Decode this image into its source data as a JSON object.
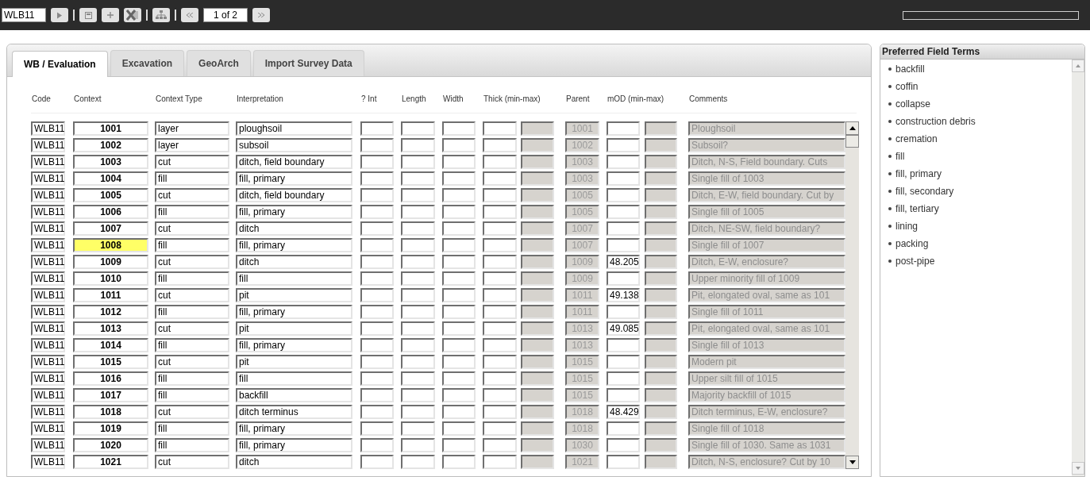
{
  "toolbar": {
    "record_code": "WLB11",
    "page": "1 of 2"
  },
  "tabs": [
    {
      "label": "WB / Evaluation",
      "selected": true
    },
    {
      "label": "Excavation",
      "selected": false
    },
    {
      "label": "GeoArch",
      "selected": false
    },
    {
      "label": "Import Survey Data",
      "selected": false
    }
  ],
  "columns": [
    "Code",
    "Context",
    "Context Type",
    "Interpretation",
    "? Int",
    "Length",
    "Width",
    "Thick (min-max)",
    "Parent",
    "mOD (min-max)",
    "Comments"
  ],
  "rows": [
    {
      "code": "WLB11",
      "context": "1001",
      "selected": false,
      "context_type": "layer",
      "interpretation": "ploughsoil",
      "parent": "1001",
      "comment": "Ploughsoil"
    },
    {
      "code": "WLB11",
      "context": "1002",
      "selected": false,
      "context_type": "layer",
      "interpretation": "subsoil",
      "parent": "1002",
      "comment": "Subsoil?"
    },
    {
      "code": "WLB11",
      "context": "1003",
      "selected": false,
      "context_type": "cut",
      "interpretation": "ditch, field boundary",
      "parent": "1003",
      "comment": "Ditch, N-S, Field boundary. Cuts"
    },
    {
      "code": "WLB11",
      "context": "1004",
      "selected": false,
      "context_type": "fill",
      "interpretation": "fill, primary",
      "parent": "1003",
      "comment": "Single fill of 1003"
    },
    {
      "code": "WLB11",
      "context": "1005",
      "selected": false,
      "context_type": "cut",
      "interpretation": "ditch, field boundary",
      "parent": "1005",
      "comment": "Ditch, E-W, field boundary. Cut by"
    },
    {
      "code": "WLB11",
      "context": "1006",
      "selected": false,
      "context_type": "fill",
      "interpretation": "fill, primary",
      "parent": "1005",
      "comment": "Single fill of 1005"
    },
    {
      "code": "WLB11",
      "context": "1007",
      "selected": false,
      "context_type": "cut",
      "interpretation": "ditch",
      "parent": "1007",
      "comment": "Ditch, NE-SW, field boundary?"
    },
    {
      "code": "WLB11",
      "context": "1008",
      "selected": true,
      "context_type": "fill",
      "interpretation": "fill, primary",
      "parent": "1007",
      "comment": "Single fill of 1007"
    },
    {
      "code": "WLB11",
      "context": "1009",
      "selected": false,
      "context_type": "cut",
      "interpretation": "ditch",
      "parent": "1009",
      "mod_min": "48.205",
      "comment": "Ditch, E-W, enclosure?"
    },
    {
      "code": "WLB11",
      "context": "1010",
      "selected": false,
      "context_type": "fill",
      "interpretation": "fill",
      "parent": "1009",
      "comment": "Upper minority fill of 1009"
    },
    {
      "code": "WLB11",
      "context": "1011",
      "selected": false,
      "context_type": "cut",
      "interpretation": "pit",
      "parent": "1011",
      "mod_min": "49.138",
      "comment": "Pit, elongated oval, same as 101"
    },
    {
      "code": "WLB11",
      "context": "1012",
      "selected": false,
      "context_type": "fill",
      "interpretation": "fill, primary",
      "parent": "1011",
      "comment": "Single fill of 1011"
    },
    {
      "code": "WLB11",
      "context": "1013",
      "selected": false,
      "context_type": "cut",
      "interpretation": "pit",
      "parent": "1013",
      "mod_min": "49.085",
      "comment": "Pit, elongated oval, same as 101"
    },
    {
      "code": "WLB11",
      "context": "1014",
      "selected": false,
      "context_type": "fill",
      "interpretation": "fill, primary",
      "parent": "1013",
      "comment": "Single fill of 1013"
    },
    {
      "code": "WLB11",
      "context": "1015",
      "selected": false,
      "context_type": "cut",
      "interpretation": "pit",
      "parent": "1015",
      "comment": "Modern pit"
    },
    {
      "code": "WLB11",
      "context": "1016",
      "selected": false,
      "context_type": "fill",
      "interpretation": "fill",
      "parent": "1015",
      "comment": "Upper silt fill of 1015"
    },
    {
      "code": "WLB11",
      "context": "1017",
      "selected": false,
      "context_type": "fill",
      "interpretation": "backfill",
      "parent": "1015",
      "comment": "Majority backfill of 1015"
    },
    {
      "code": "WLB11",
      "context": "1018",
      "selected": false,
      "context_type": "cut",
      "interpretation": "ditch terminus",
      "parent": "1018",
      "mod_min": "48.429",
      "comment": "Ditch terminus, E-W, enclosure?"
    },
    {
      "code": "WLB11",
      "context": "1019",
      "selected": false,
      "context_type": "fill",
      "interpretation": "fill, primary",
      "parent": "1018",
      "comment": "Single fill of 1018"
    },
    {
      "code": "WLB11",
      "context": "1020",
      "selected": false,
      "context_type": "fill",
      "interpretation": "fill, primary",
      "parent": "1030",
      "comment": "Single fill of 1030. Same as 1031"
    },
    {
      "code": "WLB11",
      "context": "1021",
      "selected": false,
      "context_type": "cut",
      "interpretation": "ditch",
      "parent": "1021",
      "comment": "Ditch, N-S, enclosure? Cut by 10"
    }
  ],
  "terms_panel": {
    "title": "Preferred Field Terms",
    "terms": [
      "backfill",
      "coffin",
      "collapse",
      "construction debris",
      "cremation",
      "fill",
      "fill, primary",
      "fill, secondary",
      "fill, tertiary",
      "lining",
      "packing",
      "post-pipe"
    ]
  }
}
